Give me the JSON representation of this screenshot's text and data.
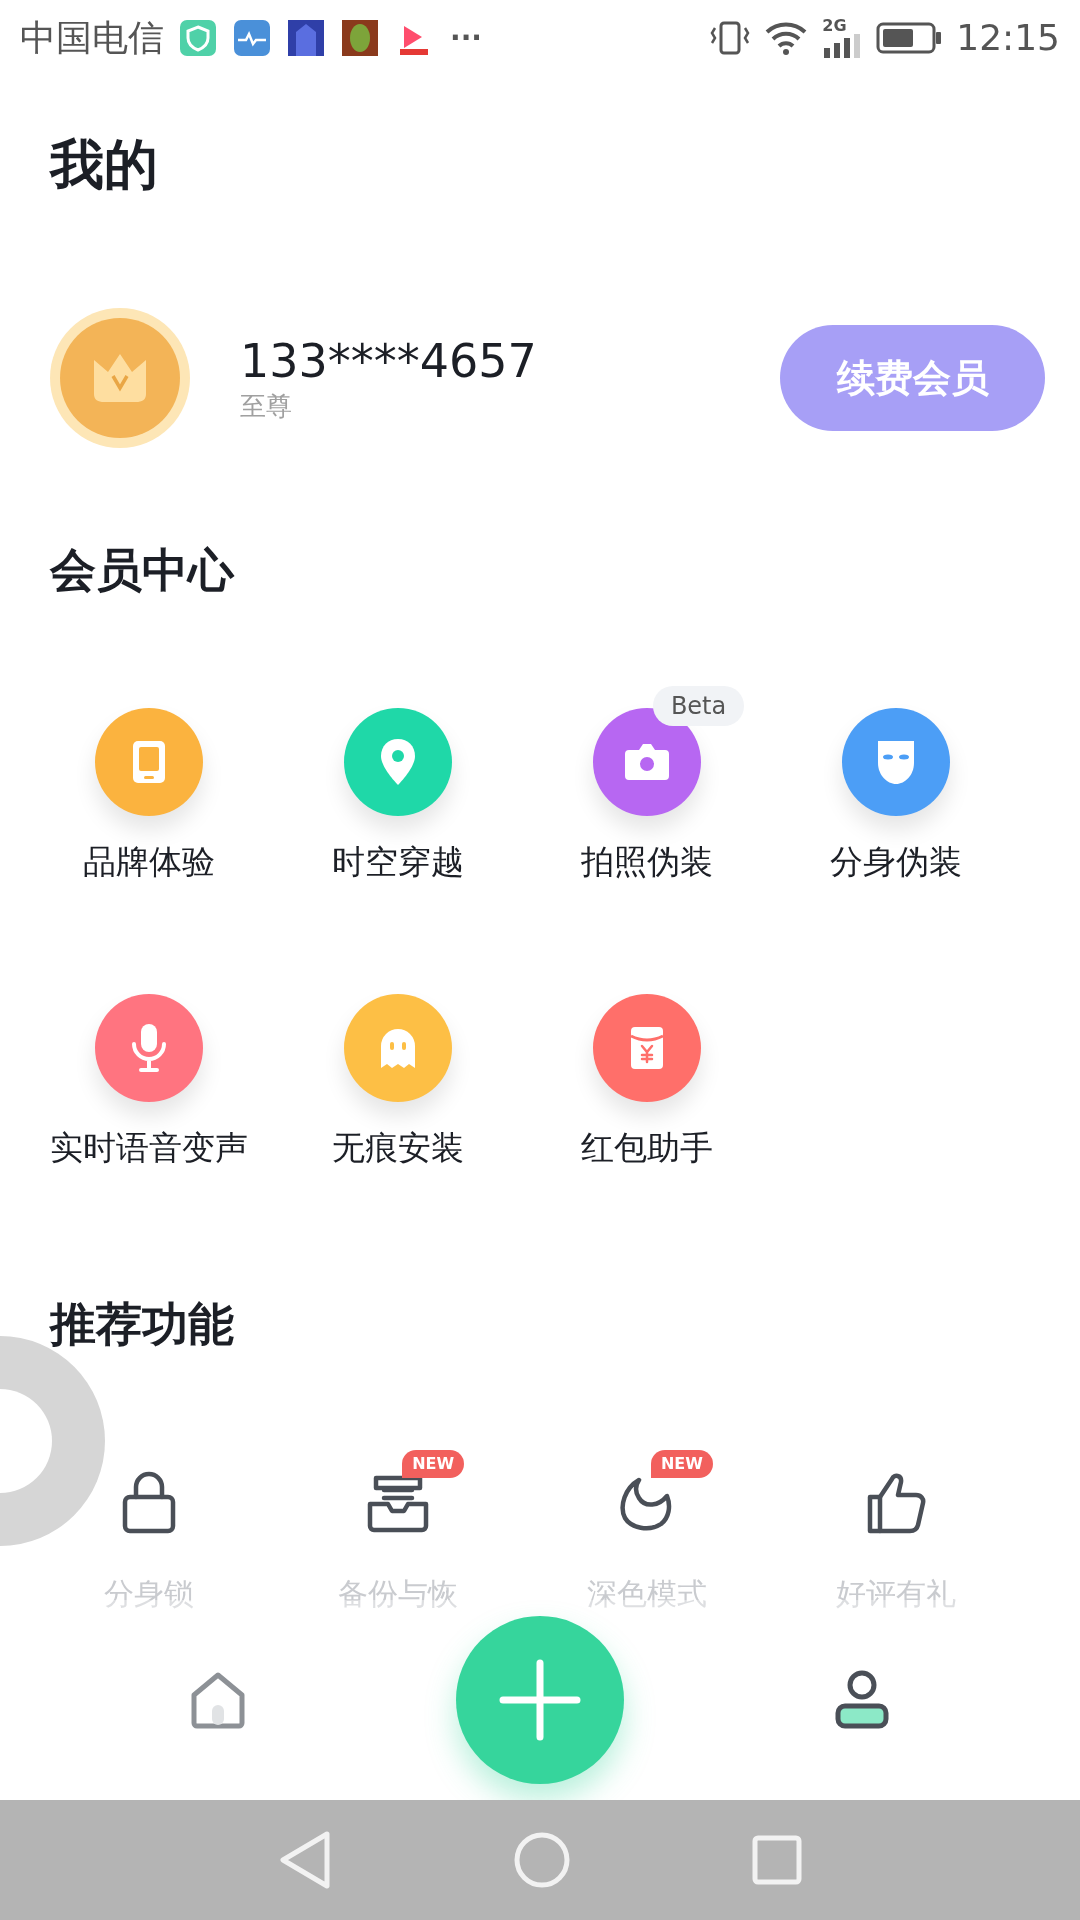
{
  "status_bar": {
    "carrier": "中国电信",
    "overflow": "···",
    "network": "2G",
    "time": "12:15"
  },
  "page_title": "我的",
  "profile": {
    "phone": "133****4657",
    "tier": "至尊",
    "renew_button": "续费会员"
  },
  "member_center": {
    "title": "会员中心",
    "items": [
      {
        "label": "品牌体验",
        "color": "#fbb33f"
      },
      {
        "label": "时空穿越",
        "color": "#1fd8a8"
      },
      {
        "label": "拍照伪装",
        "color": "#b767f2",
        "badge": "Beta"
      },
      {
        "label": "分身伪装",
        "color": "#4c9ef6"
      },
      {
        "label": "实时语音变声",
        "color": "#ff7480"
      },
      {
        "label": "无痕安装",
        "color": "#fdbf45"
      },
      {
        "label": "红包助手",
        "color": "#ff6f6a"
      }
    ]
  },
  "recommended": {
    "title": "推荐功能",
    "items": [
      {
        "label": "分身锁"
      },
      {
        "label": "备份与恢",
        "badge": "NEW"
      },
      {
        "label": "深色模式",
        "badge": "NEW"
      },
      {
        "label": "好评有礼"
      }
    ]
  },
  "bottom_nav": [
    {
      "selected": false
    },
    {
      "selected": true
    }
  ]
}
